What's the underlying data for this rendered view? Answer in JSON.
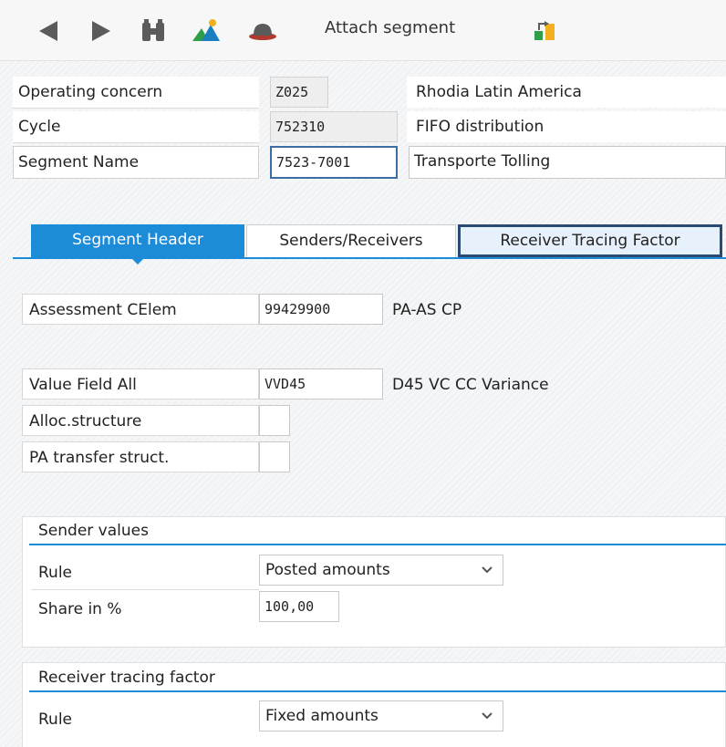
{
  "toolbar": {
    "back_icon": "left-triangle-icon",
    "forward_icon": "right-triangle-icon",
    "find_icon": "binoculars-icon",
    "chart_icon": "mountain-chart-icon",
    "hat_icon": "hat-icon",
    "attach_label": "Attach segment",
    "attach_icon": "attach-icon"
  },
  "header": {
    "operating_concern": {
      "label": "Operating concern",
      "value": "Z025",
      "desc": "Rhodia Latin America"
    },
    "cycle": {
      "label": "Cycle",
      "value": "752310",
      "desc": "FIFO distribution"
    },
    "segment_name": {
      "label": "Segment Name",
      "value": "7523-7001",
      "desc": "Transporte Tolling"
    }
  },
  "tabs": [
    {
      "label": "Segment Header",
      "state": "active"
    },
    {
      "label": "Senders/Receivers",
      "state": "normal"
    },
    {
      "label": "Receiver Tracing Factor",
      "state": "focused"
    }
  ],
  "segment_header": {
    "assessment_celem": {
      "label": "Assessment CElem",
      "value": "99429900",
      "desc": "PA-AS CP"
    },
    "value_field_all": {
      "label": "Value Field All",
      "value": "VVD45",
      "desc": "D45 VC CC Variance"
    },
    "alloc_structure": {
      "label": "Alloc.structure"
    },
    "pa_transfer_struct": {
      "label": "PA transfer struct."
    }
  },
  "sender_values": {
    "title": "Sender values",
    "rule": {
      "label": "Rule",
      "value": "Posted amounts"
    },
    "share": {
      "label": "Share in %",
      "value": "100,00"
    }
  },
  "receiver_tracing": {
    "title": "Receiver tracing factor",
    "rule": {
      "label": "Rule",
      "value": "Fixed amounts"
    }
  },
  "colors": {
    "accent": "#1c8bd8",
    "focus": "#2b4a73"
  }
}
